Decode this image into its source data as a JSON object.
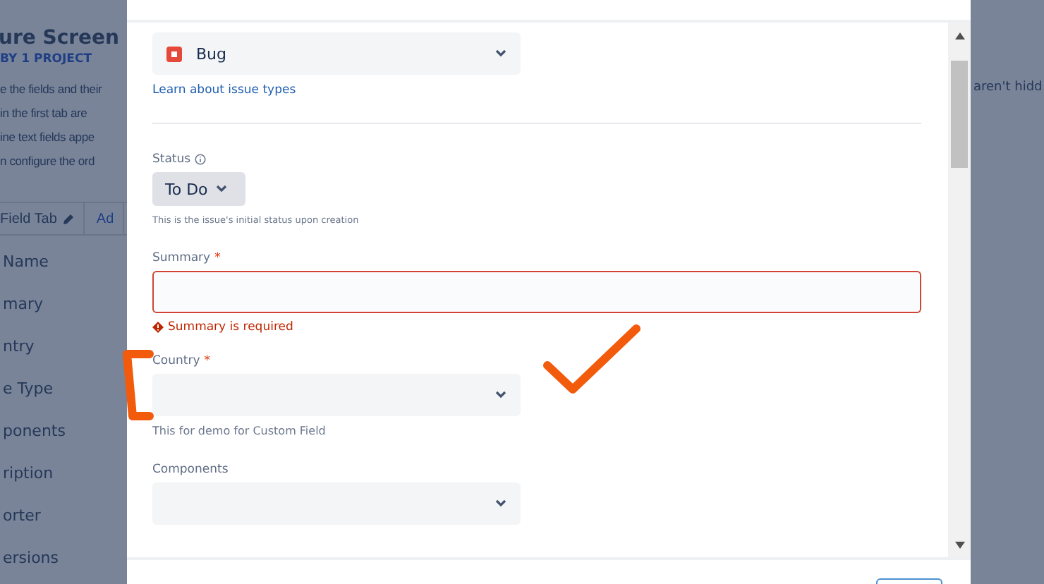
{
  "background_page": {
    "title": "ure Screen",
    "subtitle": "BY 1 PROJECT",
    "description_lines": [
      "e the fields and their",
      "in the first tab are",
      "ine text fields appe",
      "n configure the ord"
    ],
    "right_text": "aren't hidd",
    "tabs": [
      "Field Tab",
      "Ad"
    ],
    "field_rows": [
      "Name",
      "mary",
      "ntry",
      "e Type",
      "ponents",
      "ription",
      "orter",
      "ersions"
    ]
  },
  "dialog": {
    "fields": [
      {
        "kind": "issue_type",
        "value": "Bug",
        "link": "Learn about issue types"
      },
      {
        "kind": "status",
        "label": "Status",
        "value": "To Do",
        "help": "This is the issue's initial status upon creation"
      },
      {
        "kind": "text",
        "label": "Summary",
        "required_mark": "*",
        "invalid": true,
        "error": "Summary is required"
      },
      {
        "kind": "select",
        "label": "Country",
        "required_mark": "*",
        "help": "This for demo for Custom Field"
      },
      {
        "kind": "select",
        "label": "Components"
      }
    ]
  }
}
